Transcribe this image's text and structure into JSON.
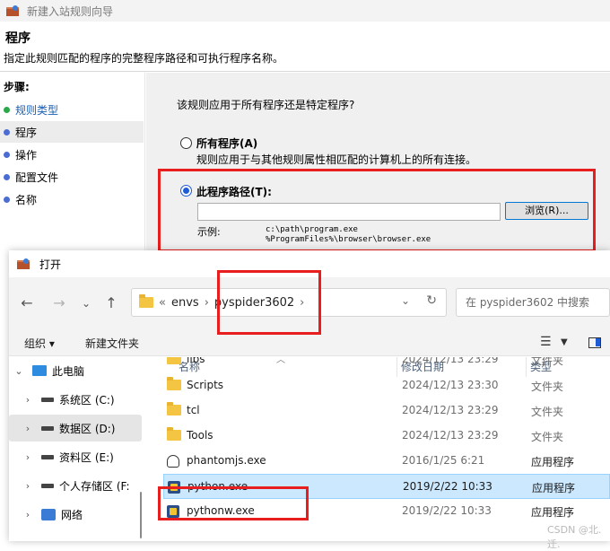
{
  "wizard": {
    "window_title": "新建入站规则向导",
    "page_title": "程序",
    "page_desc": "指定此规则匹配的程序的完整程序路径和可执行程序名称。",
    "steps_label": "步骤:",
    "steps": [
      {
        "label": "规则类型",
        "state": "done"
      },
      {
        "label": "程序",
        "state": "current"
      },
      {
        "label": "操作",
        "state": "pending"
      },
      {
        "label": "配置文件",
        "state": "pending"
      },
      {
        "label": "名称",
        "state": "pending"
      }
    ],
    "question": "该规则应用于所有程序还是特定程序?",
    "option_all": {
      "label": "所有程序(A)",
      "desc": "规则应用于与其他规则属性相匹配的计算机上的所有连接。",
      "selected": false
    },
    "option_path": {
      "label": "此程序路径(T):",
      "selected": true
    },
    "path_value": "",
    "browse_label": "浏览(R)...",
    "example_label": "示例:",
    "example_lines": [
      "c:\\path\\program.exe",
      "%ProgramFiles%\\browser\\browser.exe"
    ]
  },
  "dialog": {
    "title": "打开",
    "path": [
      "envs",
      "pyspider3602"
    ],
    "search_placeholder": "在 pyspider3602 中搜索",
    "toolbar": {
      "organize": "组织 ▾",
      "new_folder": "新建文件夹"
    },
    "nav": [
      {
        "label": "此电脑",
        "kind": "pc"
      },
      {
        "label": "系统区 (C:)",
        "kind": "drive"
      },
      {
        "label": "数据区 (D:)",
        "kind": "drive"
      },
      {
        "label": "资料区 (E:)",
        "kind": "drive"
      },
      {
        "label": "个人存储区 (F:",
        "kind": "drive"
      },
      {
        "label": "网络",
        "kind": "network"
      }
    ],
    "columns": {
      "name": "名称",
      "date": "修改日期",
      "type": "类型"
    },
    "files": [
      {
        "name": "libs",
        "date": "2024/12/13 23:29",
        "type": "文件夹",
        "kind": "folder"
      },
      {
        "name": "Scripts",
        "date": "2024/12/13 23:30",
        "type": "文件夹",
        "kind": "folder"
      },
      {
        "name": "tcl",
        "date": "2024/12/13 23:29",
        "type": "文件夹",
        "kind": "folder"
      },
      {
        "name": "Tools",
        "date": "2024/12/13 23:29",
        "type": "文件夹",
        "kind": "folder"
      },
      {
        "name": "phantomjs.exe",
        "date": "2016/1/25 6:21",
        "type": "应用程序",
        "kind": "ghost"
      },
      {
        "name": "python.exe",
        "date": "2019/2/22 10:33",
        "type": "应用程序",
        "kind": "exe",
        "selected": true
      },
      {
        "name": "pythonw.exe",
        "date": "2019/2/22 10:33",
        "type": "应用程序",
        "kind": "exe"
      }
    ],
    "watermark": "CSDN @北.迁."
  }
}
